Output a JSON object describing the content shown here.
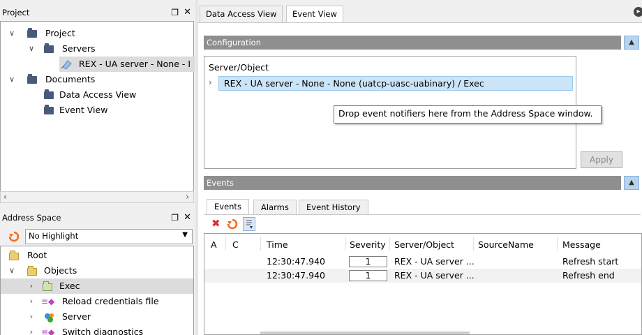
{
  "project_pane": {
    "title": "Project",
    "pin_glyph": "❐",
    "close_glyph": "✕",
    "tree": {
      "root": "Project",
      "servers": "Servers",
      "server_item": "REX - UA server - None - I",
      "documents": "Documents",
      "doc1": "Data Access View",
      "doc2": "Event View"
    }
  },
  "address_pane": {
    "title": "Address Space",
    "highlight_value": "No Highlight",
    "tree": {
      "root": "Root",
      "objects": "Objects",
      "exec": "Exec",
      "reload": "Reload credentials file",
      "server": "Server",
      "switch": "Switch diagnostics"
    }
  },
  "tabs": [
    "Data Access View",
    "Event View"
  ],
  "configuration": {
    "title": "Configuration",
    "column_header": "Server/Object",
    "row": "REX - UA server - None - None (uatcp-uasc-uabinary) / Exec",
    "tooltip": "Drop event notifiers here from the Address Space window.",
    "apply_label": "Apply"
  },
  "events": {
    "title": "Events",
    "tabs": [
      "Events",
      "Alarms",
      "Event History"
    ],
    "columns": [
      "A",
      "C",
      "Time",
      "Severity",
      "Server/Object",
      "SourceName",
      "Message"
    ],
    "rows": [
      {
        "time": "12:30:47.940",
        "severity": "1",
        "server_object": "REX - UA server ...",
        "message": "Refresh start"
      },
      {
        "time": "12:30:47.940",
        "severity": "1",
        "server_object": "REX - UA server ...",
        "message": "Refresh end"
      }
    ]
  },
  "colors": {
    "section_bar": "#8f8f8f",
    "selection": "#cce4f7",
    "refresh_icon": "#f07020",
    "delete_icon": "#d83030"
  }
}
